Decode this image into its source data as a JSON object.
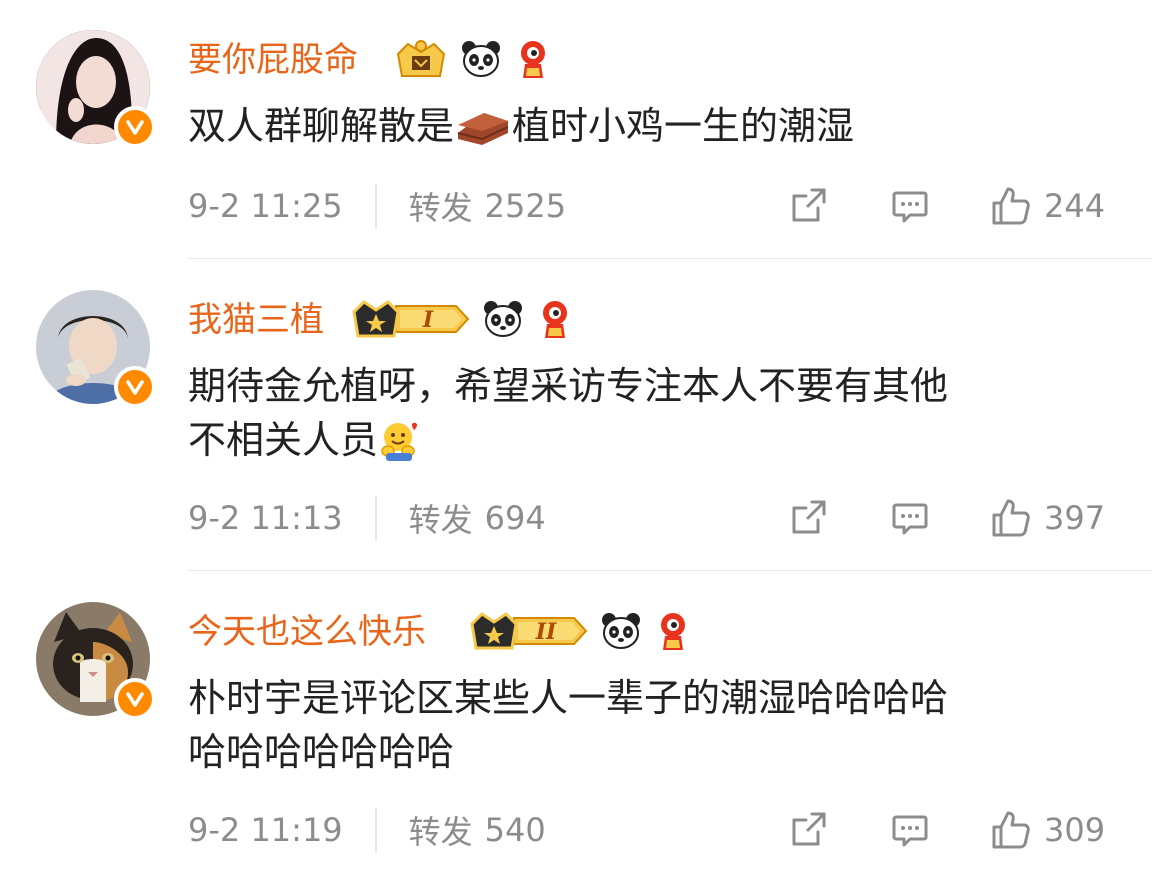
{
  "comments": [
    {
      "username": "要你屁股命",
      "text_before_emoji": "双人群聊解散是",
      "emoji_inline": "brick-emoji",
      "text_after_emoji": "植时小鸡一生的潮湿",
      "time": "9-2 11:25",
      "repost_label": "转发",
      "repost_count": "2525",
      "likes": "244",
      "crown_level": "",
      "verified_color": "#ff8a00"
    },
    {
      "username": "我猫三植",
      "text_line1": "期待金允植呀，希望采访专注本人不要有其他",
      "text_line2": "不相关人员",
      "emoji_inline": "hug-emoji",
      "time": "9-2 11:13",
      "repost_label": "转发",
      "repost_count": "694",
      "likes": "397",
      "crown_level": "I",
      "verified_color": "#ff8a00"
    },
    {
      "username": "今天也这么快乐",
      "text_line1": "朴时宇是评论区某些人一辈子的潮湿哈哈哈哈",
      "text_line2": "哈哈哈哈哈哈哈",
      "time": "9-2 11:19",
      "repost_label": "转发",
      "repost_count": "540",
      "likes": "309",
      "crown_level": "II",
      "verified_color": "#ff8a00"
    }
  ],
  "icons": {
    "share": "share-icon",
    "comment": "comment-icon",
    "like": "thumbs-up-icon",
    "badges": [
      "crown-badge",
      "panda-icon",
      "fire-mascot-icon"
    ]
  },
  "colors": {
    "username": "#e8651a",
    "meta": "#8c8c8c",
    "badge_gold": "#f5b400"
  }
}
